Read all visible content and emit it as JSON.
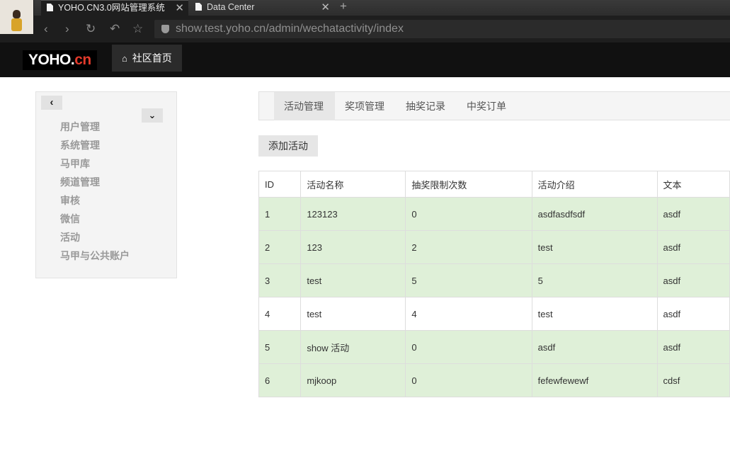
{
  "browser": {
    "tabs": [
      {
        "title": "YOHO.CN3.0网站管理系统",
        "active": true
      },
      {
        "title": "Data Center",
        "active": false
      }
    ],
    "close_glyph": "✕",
    "new_tab_glyph": "+",
    "url": "show.test.yoho.cn/admin/wechatactivity/index"
  },
  "header": {
    "logo_main": "YOHO.",
    "logo_cn": "cn",
    "home_link": "社区首页"
  },
  "sidebar": {
    "items": [
      "用户管理",
      "系统管理",
      "马甲库",
      "频道管理",
      "审核",
      "微信",
      "活动",
      "马甲与公共账户"
    ]
  },
  "main": {
    "tabs": [
      {
        "label": "活动管理",
        "active": true
      },
      {
        "label": "奖项管理",
        "active": false
      },
      {
        "label": "抽奖记录",
        "active": false
      },
      {
        "label": "中奖订单",
        "active": false
      }
    ],
    "add_button": "添加活动",
    "table": {
      "columns": [
        "ID",
        "活动名称",
        "抽奖限制次数",
        "活动介绍",
        "文本"
      ],
      "rows": [
        {
          "id": "1",
          "name": "123123",
          "limit": "0",
          "intro": "asdfasdfsdf",
          "extra": "asdf",
          "highlight": true
        },
        {
          "id": "2",
          "name": "123",
          "limit": "2",
          "intro": "test",
          "extra": "asdf",
          "highlight": true
        },
        {
          "id": "3",
          "name": "test",
          "limit": "5",
          "intro": "5",
          "extra": "asdf",
          "highlight": true
        },
        {
          "id": "4",
          "name": "test",
          "limit": "4",
          "intro": "test",
          "extra": "asdf",
          "highlight": false
        },
        {
          "id": "5",
          "name": "show 活动",
          "limit": "0",
          "intro": "asdf",
          "extra": "asdf",
          "highlight": true
        },
        {
          "id": "6",
          "name": "mjkoop",
          "limit": "0",
          "intro": "fefewfewewf",
          "extra": "cdsf",
          "highlight": true
        }
      ]
    }
  },
  "colors": {
    "row_highlight": "#dff0d8",
    "logo_accent": "#e23a2b"
  }
}
